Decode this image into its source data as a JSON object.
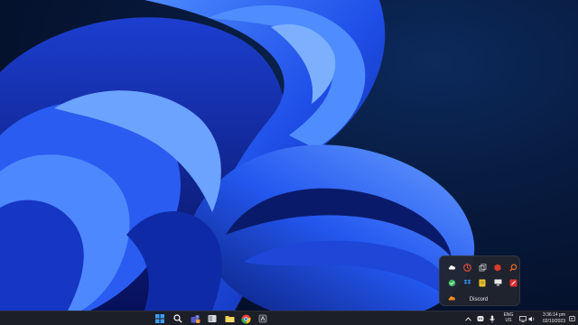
{
  "wallpaper": {
    "name": "Windows 11 Bloom",
    "colors": {
      "light": "#3d7bff",
      "mid": "#1a3fe0",
      "dark": "#0a1a70",
      "background": "#061634"
    }
  },
  "tray_flyout": {
    "tooltip": "Discord",
    "icons": [
      {
        "name": "onedrive-icon",
        "color": "#ffffff"
      },
      {
        "name": "security-icon",
        "color": "#e14b3a"
      },
      {
        "name": "copy-icon",
        "color": "#c8c8c8"
      },
      {
        "name": "app-red-icon",
        "color": "#d83b2b"
      },
      {
        "name": "search-tool-icon",
        "color": "#e8692a"
      },
      {
        "name": "sync-icon",
        "color": "#3cb35a"
      },
      {
        "name": "dropbox-icon",
        "color": "#2f8de4"
      },
      {
        "name": "notes-icon",
        "color": "#f0c531"
      },
      {
        "name": "monitor-icon",
        "color": "#e6e6e6"
      },
      {
        "name": "red-app-icon",
        "color": "#e02d2d"
      },
      {
        "name": "cloud-orange-icon",
        "color": "#f08a24"
      }
    ]
  },
  "taskbar": {
    "apps": [
      {
        "name": "start-button",
        "color": "#3b9cf0"
      },
      {
        "name": "search-button",
        "color": "#ffffff"
      },
      {
        "name": "teams-button",
        "color": "#7a86f0"
      },
      {
        "name": "widgets-button",
        "color": "#d9d9d9"
      },
      {
        "name": "file-explorer-button",
        "color": "#f2c94c"
      },
      {
        "name": "chrome-button",
        "color": "#e94235"
      },
      {
        "name": "app-button",
        "color": "#9aa0a6"
      }
    ],
    "tray": {
      "chevron": "^",
      "language_line1": "ENG",
      "language_line2": "US",
      "time": "3:36:14 pm",
      "date": "02/10/2023"
    }
  }
}
